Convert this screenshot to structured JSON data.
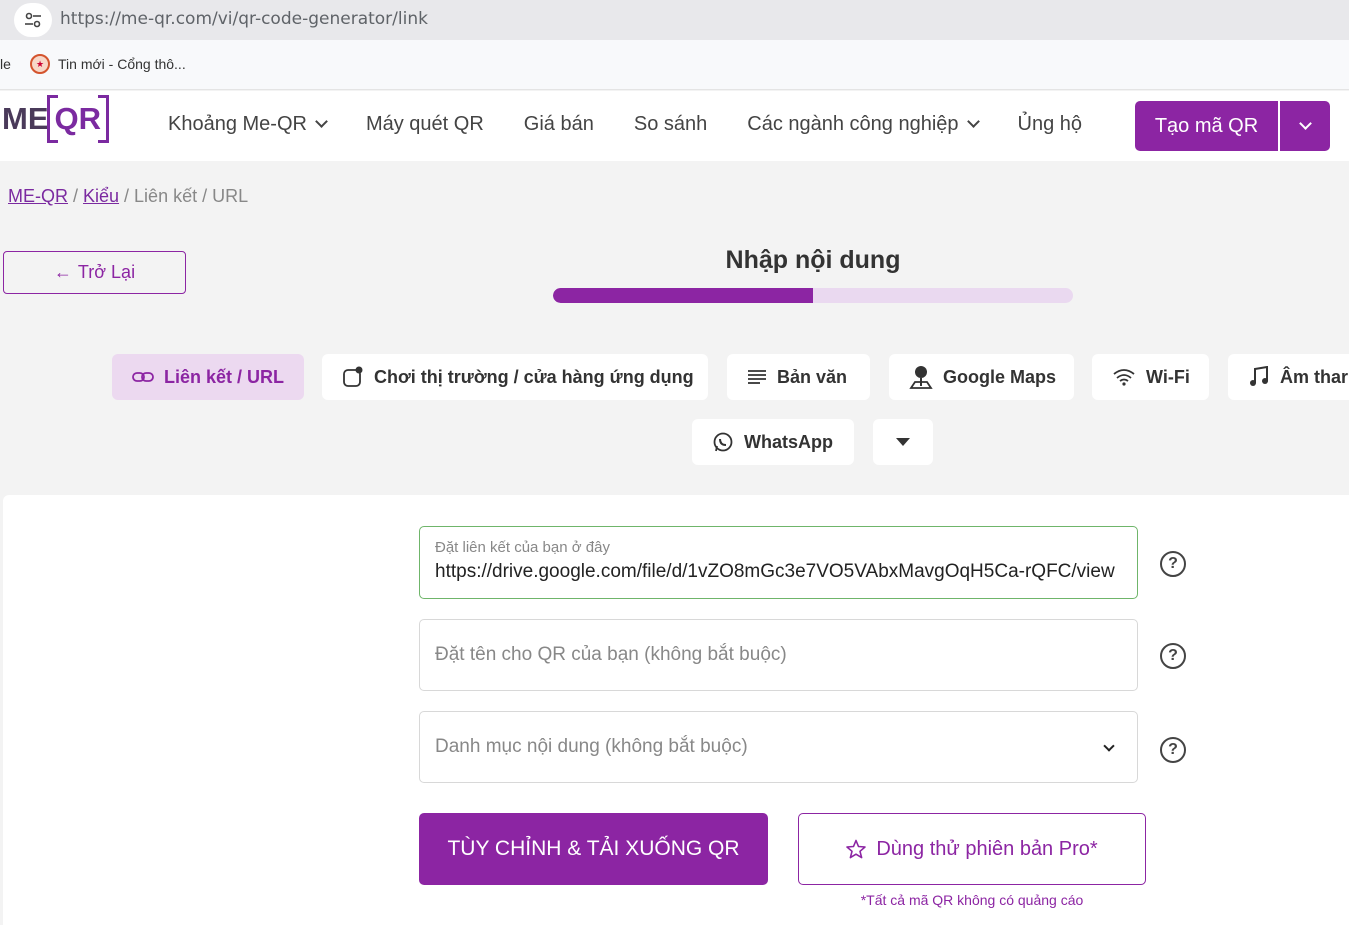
{
  "browser": {
    "url": "https://me-qr.com/vi/qr-code-generator/link",
    "bookmark_left_fragment": "le",
    "bookmark_label": "Tin mới - Cổng thô..."
  },
  "header": {
    "logo_me": "ME",
    "logo_qr": "QR",
    "nav": [
      {
        "label": "Khoảng Me-QR",
        "has_dropdown": true
      },
      {
        "label": "Máy quét QR",
        "has_dropdown": false
      },
      {
        "label": "Giá bán",
        "has_dropdown": false
      },
      {
        "label": "So sánh",
        "has_dropdown": false
      },
      {
        "label": "Các ngành công nghiệp",
        "has_dropdown": true
      },
      {
        "label": "Ủng hộ",
        "has_dropdown": false
      }
    ],
    "create_button": "Tạo mã QR"
  },
  "breadcrumb": {
    "home": "ME-QR",
    "sep1": " / ",
    "types": "Kiểu",
    "rest": " / Liên kết / URL"
  },
  "back_button": "Trở Lại",
  "step": {
    "title": "Nhập nội dung",
    "progress_percent": 50
  },
  "tabs": [
    {
      "label": "Liên kết / URL",
      "icon": "link-icon",
      "active": true
    },
    {
      "label": "Chơi thị trường / cửa hàng ứng dụng",
      "icon": "app-store-icon",
      "active": false
    },
    {
      "label": "Bản văn",
      "icon": "text-lines-icon",
      "active": false
    },
    {
      "label": "Google Maps",
      "icon": "map-pin-icon",
      "active": false
    },
    {
      "label": "Wi-Fi",
      "icon": "wifi-icon",
      "active": false
    },
    {
      "label": "Âm thar",
      "icon": "music-note-icon",
      "active": false
    },
    {
      "label": "WhatsApp",
      "icon": "whatsapp-icon",
      "active": false
    }
  ],
  "form": {
    "link_label": "Đặt liên kết của bạn ở đây",
    "link_value": "https://drive.google.com/file/d/1vZO8mGc3e7VO5VAbxMavgOqH5Ca-rQFC/view",
    "name_placeholder": "Đặt tên cho QR của bạn (không bắt buộc)",
    "category_placeholder": "Danh mục nội dung (không bắt buộc)",
    "help_symbol": "?"
  },
  "actions": {
    "primary": "TÙY CHỈNH & TẢI XUỐNG QR",
    "pro": "Dùng thử phiên bản Pro*",
    "note": "*Tất cả mã QR không có quảng cáo"
  },
  "colors": {
    "brand": "#8c25a3",
    "brand_light": "#ecd9f0",
    "active_field_border": "#6fb56a"
  }
}
